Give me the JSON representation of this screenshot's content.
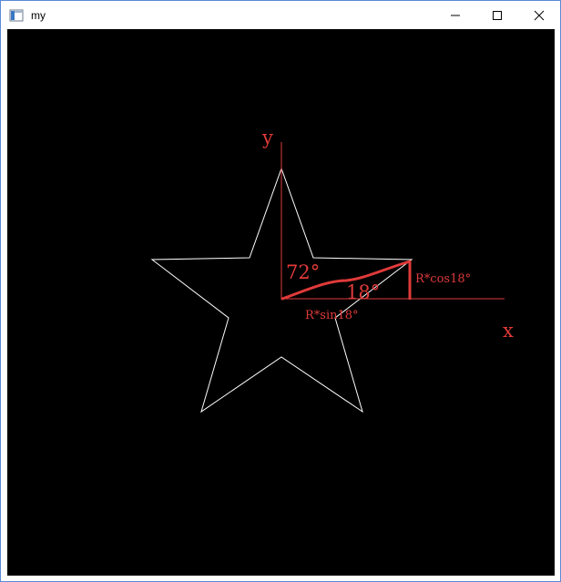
{
  "window": {
    "title": "my",
    "controls": {
      "minimize_icon": "minimize-icon",
      "maximize_icon": "maximize-icon",
      "close_icon": "close-icon"
    }
  },
  "canvas": {
    "background": "#000000",
    "star_color": "#ffffff",
    "annotation_color": "#e03a3a",
    "labels": {
      "y_axis": "y",
      "x_axis": "x",
      "angle_72": "72°",
      "angle_18": "18°",
      "r_cos": "R*cos18°",
      "r_sin": "R*sin18°"
    }
  }
}
